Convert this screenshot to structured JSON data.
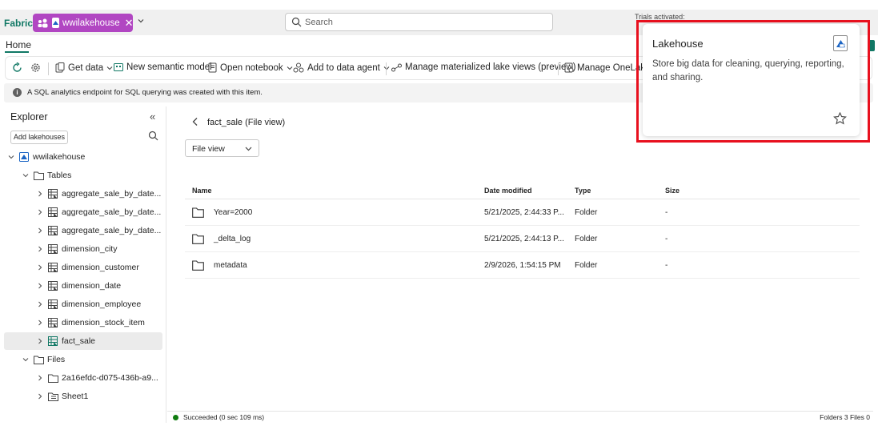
{
  "topbar": {
    "brand": "Fabric",
    "workspace": "wwilakehouse",
    "search_placeholder": "Search",
    "trials": "Trials activated:"
  },
  "tabs": {
    "home": "Home"
  },
  "ribbon": {
    "get_data": "Get data",
    "new_semantic_model": "New semantic model",
    "open_notebook": "Open notebook",
    "add_to_data_agent": "Add to data agent",
    "manage_mlv": "Manage materialized lake views (preview)",
    "manage_onelake": "Manage OneLak"
  },
  "info": {
    "message": "A SQL analytics endpoint for SQL querying was created with this item."
  },
  "explorer": {
    "title": "Explorer",
    "add_lakehouses": "Add lakehouses",
    "root": "wwilakehouse",
    "tables_label": "Tables",
    "tables": [
      "aggregate_sale_by_date...",
      "aggregate_sale_by_date...",
      "aggregate_sale_by_date...",
      "dimension_city",
      "dimension_customer",
      "dimension_date",
      "dimension_employee",
      "dimension_stock_item",
      "fact_sale"
    ],
    "files_label": "Files",
    "files": [
      "2a16efdc-d075-436b-a9...",
      "Sheet1"
    ]
  },
  "main": {
    "breadcrumb": "fact_sale (File view)",
    "view_select": "File view",
    "columns": {
      "name": "Name",
      "date": "Date modified",
      "type": "Type",
      "size": "Size"
    },
    "rows": [
      {
        "name": "Year=2000",
        "date": "5/21/2025, 2:44:33 P...",
        "type": "Folder",
        "size": "-"
      },
      {
        "name": "_delta_log",
        "date": "5/21/2025, 2:44:13 P...",
        "type": "Folder",
        "size": "-"
      },
      {
        "name": "metadata",
        "date": "2/9/2026, 1:54:15 PM",
        "type": "Folder",
        "size": "-"
      }
    ]
  },
  "status": {
    "message": "Succeeded (0 sec 109 ms)",
    "counts": "Folders 3 Files 0"
  },
  "card": {
    "title": "Lakehouse",
    "description": "Store big data for cleaning, querying, reporting, and sharing."
  },
  "colors": {
    "accent": "#117865",
    "workspace": "#b146c2",
    "highlight": "#e8101e"
  }
}
